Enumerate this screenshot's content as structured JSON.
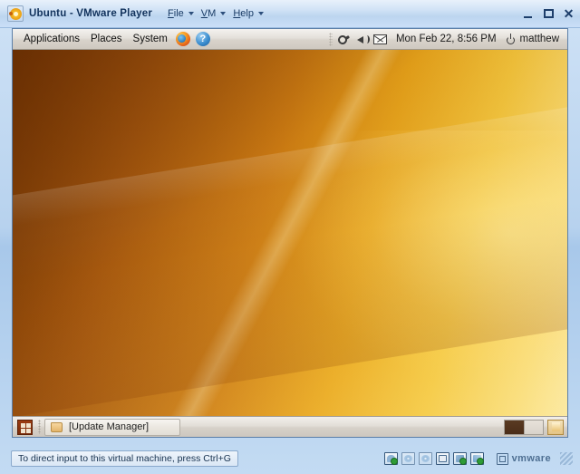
{
  "window": {
    "title": "Ubuntu - VMware Player",
    "app_icon": "ubuntu-logo-icon",
    "menus": [
      {
        "label": "File",
        "accel": "F",
        "rest": "ile"
      },
      {
        "label": "VM",
        "accel": "V",
        "rest": "M"
      },
      {
        "label": "Help",
        "accel": "H",
        "rest": "elp"
      }
    ],
    "controls": {
      "minimize": "minimize-button",
      "maximize": "maximize-button",
      "close": "close-button"
    }
  },
  "guest": {
    "top_panel": {
      "menus": [
        "Applications",
        "Places",
        "System"
      ],
      "launchers": [
        {
          "name": "firefox-icon",
          "label": "Firefox Web Browser"
        },
        {
          "name": "help-icon",
          "label": "?"
        }
      ],
      "tray": [
        {
          "name": "network-plug-icon"
        },
        {
          "name": "volume-speaker-icon"
        },
        {
          "name": "mail-envelope-icon"
        }
      ],
      "clock": "Mon Feb 22,  8:56 PM",
      "power_icon": "power-icon",
      "username": "matthew"
    },
    "bottom_panel": {
      "show_desktop": "show-desktop-icon",
      "tasks": [
        {
          "label": "[Update Manager]",
          "icon": "window-icon"
        }
      ],
      "workspaces": [
        {
          "name": "workspace-1",
          "active": true
        },
        {
          "name": "workspace-2",
          "active": false
        }
      ],
      "trash": "trash-icon"
    }
  },
  "statusbar": {
    "message": "To direct input to this virtual machine, press Ctrl+G",
    "devices": [
      {
        "name": "hard-disk-icon",
        "connected": true
      },
      {
        "name": "cdrom-icon",
        "connected": false
      },
      {
        "name": "cdrom2-icon",
        "connected": false
      },
      {
        "name": "floppy-icon",
        "connected": false
      },
      {
        "name": "network-adapter-icon",
        "connected": true
      },
      {
        "name": "usb-device-icon",
        "connected": true
      }
    ],
    "brand": "vmware",
    "resize_grip": "resize-grip-icon"
  },
  "colors": {
    "titlebar_blue": "#cadef7",
    "desktop_orange": "#cf7f14",
    "panel_grey": "#e4e0da",
    "accent_text": "#11325c"
  }
}
